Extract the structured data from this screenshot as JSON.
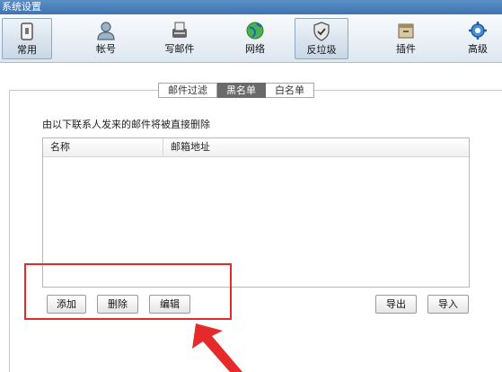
{
  "window": {
    "title": "系统设置"
  },
  "toolbar": {
    "items": [
      {
        "label": "常用",
        "icon": "general-icon"
      },
      {
        "label": "帐号",
        "icon": "account-icon"
      },
      {
        "label": "写邮件",
        "icon": "compose-icon"
      },
      {
        "label": "网络",
        "icon": "network-icon"
      },
      {
        "label": "反垃圾",
        "icon": "antispam-icon"
      },
      {
        "label": "插件",
        "icon": "plugin-icon"
      },
      {
        "label": "高级",
        "icon": "advanced-icon"
      }
    ],
    "active": "反垃圾"
  },
  "tabs": [
    {
      "label": "邮件过滤"
    },
    {
      "label": "黑名单"
    },
    {
      "label": "白名单"
    }
  ],
  "active_tab": "黑名单",
  "blacklist": {
    "description": "由以下联系人发来的邮件将被直接删除",
    "columns": [
      "名称",
      "邮箱地址"
    ],
    "rows": []
  },
  "buttons": {
    "add": "添加",
    "delete": "删除",
    "edit": "编辑",
    "export": "导出",
    "import": "导入"
  },
  "colors": {
    "titlebar": "#4a7fbd",
    "highlight": "#e52a2a",
    "active_tab": "#6a6a6a"
  }
}
